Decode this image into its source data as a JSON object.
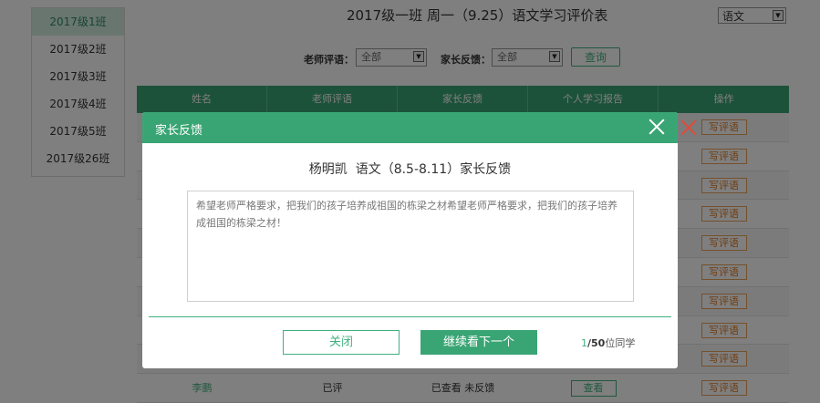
{
  "sidebar": {
    "items": [
      {
        "label": "2017级1班",
        "active": true
      },
      {
        "label": "2017级2班",
        "active": false
      },
      {
        "label": "2017级3班",
        "active": false
      },
      {
        "label": "2017级4班",
        "active": false
      },
      {
        "label": "2017级5班",
        "active": false
      },
      {
        "label": "2017级26班",
        "active": false
      }
    ]
  },
  "header": {
    "title": "2017级一班 周一（9.25）语文学习评价表",
    "subject_select": "语文"
  },
  "filters": {
    "teacher_comment_label": "老师评语：",
    "teacher_comment_value": "全部",
    "parent_feedback_label": "家长反馈：",
    "parent_feedback_value": "全部",
    "query_button": "查询"
  },
  "table": {
    "headers": [
      "姓名",
      "老师评语",
      "家长反馈",
      "个人学习报告",
      "操作"
    ],
    "write_label": "写评语",
    "row_count": 10,
    "last_row": {
      "name": "李鹏",
      "teacher_comment": "已评",
      "parent_feedback": "已查看 未反馈",
      "report_button": "查看",
      "action_button": "写评语"
    }
  },
  "modal": {
    "title": "家长反馈",
    "subtitle": "杨明凯  语文（8.5-8.11）家长反馈",
    "feedback_text": "希望老师严格要求，把我们的孩子培养成祖国的栋梁之材希望老师严格要求，把我们的孩子培养成祖国的栋梁之材！",
    "close_button": "关闭",
    "next_button": "继续看下一个",
    "pager_current": "1",
    "pager_total": "/50",
    "pager_suffix": "位同学"
  },
  "colors": {
    "primary": "#3aa574",
    "warning": "#e07a1f",
    "danger": "#e04b3a"
  }
}
